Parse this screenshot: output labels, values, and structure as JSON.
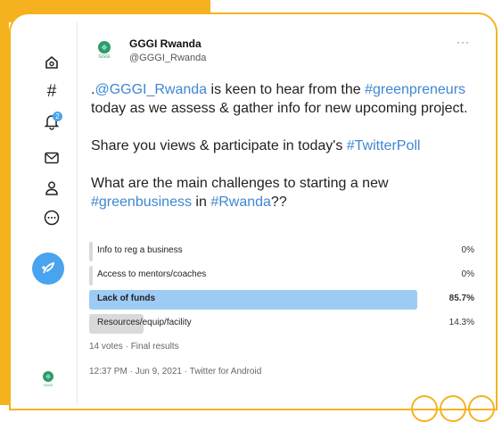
{
  "account": {
    "name": "GGGI Rwanda",
    "handle": "@GGGI_Rwanda",
    "logo_text": "GGGI"
  },
  "more_label": "···",
  "tweet": {
    "p1": [
      {
        "text": ".",
        "link": false
      },
      {
        "text": "@GGGI_Rwanda",
        "link": true
      },
      {
        "text": " is keen to hear from the ",
        "link": false
      },
      {
        "text": "#greenpreneurs",
        "link": true
      },
      {
        "text": " today as we assess & gather info for new upcoming project.",
        "link": false
      }
    ],
    "p2": [
      {
        "text": "Share you views & participate in today's ",
        "link": false
      },
      {
        "text": "#TwitterPoll",
        "link": true
      }
    ],
    "p3": [
      {
        "text": "What are the main challenges to starting a new ",
        "link": false
      },
      {
        "text": "#greenbusiness",
        "link": true
      },
      {
        "text": " in ",
        "link": false
      },
      {
        "text": "#Rwanda",
        "link": true
      },
      {
        "text": "??",
        "link": false
      }
    ]
  },
  "poll": {
    "options": [
      {
        "label": "Info to reg a business",
        "percent": "0%",
        "fraction": 0.0,
        "winner": false
      },
      {
        "label": "Access to mentors/coaches",
        "percent": "0%",
        "fraction": 0.0,
        "winner": false
      },
      {
        "label": "Lack of funds",
        "percent": "85.7%",
        "fraction": 0.857,
        "winner": true
      },
      {
        "label": "Resources/equip/facility",
        "percent": "14.3%",
        "fraction": 0.143,
        "winner": false
      }
    ],
    "summary": "14 votes · Final results"
  },
  "timestamp": "12:37 PM · Jun 9, 2021 · Twitter for Android",
  "notification_count": "2",
  "colors": {
    "accent": "#f5b21e",
    "link": "#3f86d3",
    "winner_bar": "#9ecbf4",
    "other_bar": "#d9d9d9",
    "tweet_button": "#4aa3ee"
  },
  "nav_icons": [
    "home-icon",
    "hashtag-icon",
    "notification-icon",
    "mail-icon",
    "profile-icon",
    "more-circle-icon"
  ]
}
